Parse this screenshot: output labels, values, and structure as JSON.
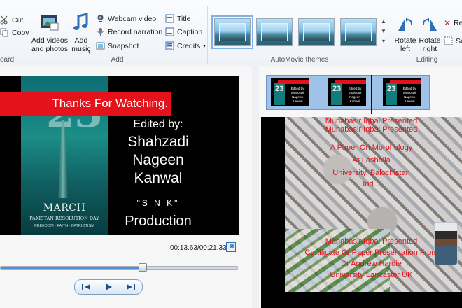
{
  "ribbon": {
    "clipboard": {
      "cut": "Cut",
      "copy": "Copy",
      "group_label": "oard"
    },
    "add": {
      "add_videos": "Add videos and photos",
      "add_music": "Add music",
      "webcam": "Webcam video",
      "record_narration": "Record narration",
      "snapshot": "Snapshot",
      "title": "Title",
      "caption": "Caption",
      "credits": "Credits",
      "group_label": "Add"
    },
    "themes": {
      "group_label": "AutoMovie themes"
    },
    "editing": {
      "rotate_left": "Rotate left",
      "rotate_right": "Rotate right",
      "remove": "Re",
      "select_all": "Se",
      "group_label": "Editing"
    }
  },
  "preview": {
    "banner": "Thanks For Watching.",
    "edited_by": "Edited  by:",
    "name_line1": "Shahzadi",
    "name_line2": "Nageen",
    "name_line3": "Kanwal",
    "snk": "\"S N K\"",
    "production": "Production",
    "poster_number": "23",
    "poster_title": "MARCH",
    "poster_subtitle": "PAKISTAN RESOLUTION DAY",
    "poster_tagline": "FREEDOM · FAITH · PATRIOTISM",
    "timecode": "00:13.63/00:21.33",
    "progress": 0.6
  },
  "storyboard": {
    "frame_number": "23",
    "frame_banner": "Thanks For Watching",
    "frame_text": "Edited by Shahzadi Nageen Kanwal",
    "clip_lines": [
      "Muhabasir Iqbal Presented",
      "Muhabasir Iqbal Presented",
      "A Paper On Morphology",
      "At Lasbella",
      "University, Balochistan",
      "Ind..."
    ],
    "clip_lines2": [
      "Muhabasir Iqbal Presented",
      "Certificate Of Paper Presentation From",
      "Dr Andrew Hardie",
      "University Lancaster UK"
    ]
  },
  "colors": {
    "accent_red": "#e3121b",
    "strip_blue": "#9fc2e8",
    "seek_blue": "#4f8fd1"
  }
}
